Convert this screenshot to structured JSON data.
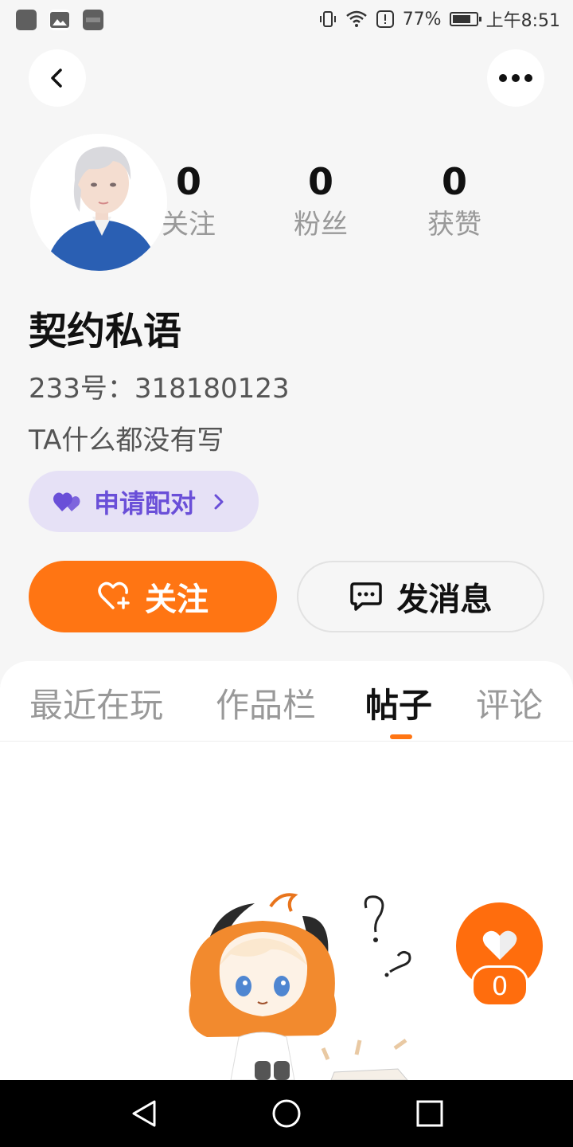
{
  "status_bar": {
    "battery_percent": "77%",
    "battery_level": 0.77,
    "time": "上午8:51",
    "left_icons": [
      "app-notification-icon",
      "gallery-icon",
      "hms-icon"
    ],
    "right_icons": [
      "vibrate-icon",
      "wifi-icon",
      "alert-icon",
      "battery-icon"
    ]
  },
  "profile": {
    "stats": [
      {
        "value": "0",
        "label": "关注"
      },
      {
        "value": "0",
        "label": "粉丝"
      },
      {
        "value": "0",
        "label": "获赞"
      }
    ],
    "name": "契约私语",
    "id_line": "233号：318180123",
    "bio": "TA什么都没有写",
    "pair_button": "申请配对"
  },
  "actions": {
    "follow": "关注",
    "message": "发消息"
  },
  "tabs": [
    {
      "label": "最近在玩",
      "active": false
    },
    {
      "label": "作品栏",
      "active": false
    },
    {
      "label": "帖子",
      "active": true
    },
    {
      "label": "评论",
      "active": false
    }
  ],
  "like_fab": {
    "count": "0"
  },
  "colors": {
    "accent": "#ff7513",
    "pair_bg": "#e6e1f6",
    "pair_text": "#6a4fd8",
    "page_bg": "#f6f6f6"
  },
  "nav_icons": [
    "back-triangle-icon",
    "home-circle-icon",
    "recents-square-icon"
  ]
}
